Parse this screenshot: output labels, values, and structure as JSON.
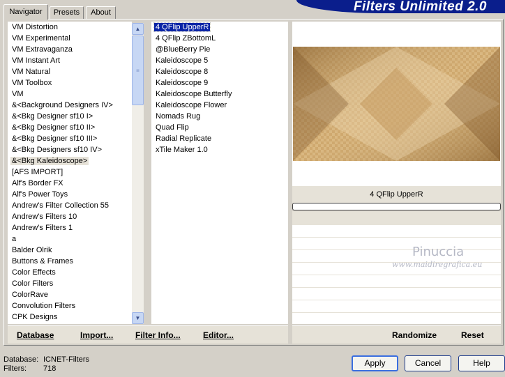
{
  "brand": {
    "title": "Filters Unlimited 2.0"
  },
  "tabs": [
    {
      "label": "Navigator"
    },
    {
      "label": "Presets"
    },
    {
      "label": "About"
    }
  ],
  "categories": [
    "VM Distortion",
    "VM Experimental",
    "VM Extravaganza",
    "VM Instant Art",
    "VM Natural",
    "VM Toolbox",
    "VM",
    "&<Background Designers IV>",
    "&<Bkg Designer sf10 I>",
    "&<Bkg Designer sf10 II>",
    "&<Bkg Designer sf10 III>",
    "&<Bkg Designers sf10 IV>",
    "&<Bkg Kaleidoscope>",
    "[AFS IMPORT]",
    "Alf's Border FX",
    "Alf's Power Toys",
    "Andrew's Filter Collection 55",
    "Andrew's Filters 10",
    "Andrew's Filters 1",
    "a",
    "Balder Olrik",
    "Buttons & Frames",
    "Color Effects",
    "Color Filters",
    "ColorRave",
    "Convolution Filters",
    "CPK Designs"
  ],
  "filters": [
    "4 QFlip UpperR",
    "4 QFlip ZBottomL",
    "@BlueBerry Pie",
    "Kaleidoscope 5",
    "Kaleidoscope 8",
    "Kaleidoscope 9",
    "Kaleidoscope Butterfly",
    "Kaleidoscope Flower",
    "Nomads Rug",
    "Quad Flip",
    "Radial Replicate",
    "xTile Maker 1.0"
  ],
  "preview": {
    "filter_name": "4 QFlip UpperR"
  },
  "watermark": {
    "name": "Pinuccia",
    "url": "www.maidiregrafica.eu"
  },
  "actions_left": {
    "database": "Database",
    "import": "Import...",
    "filter_info": "Filter Info...",
    "editor": "Editor..."
  },
  "actions_right": {
    "randomize": "Randomize",
    "reset": "Reset"
  },
  "status": {
    "database_label": "Database:",
    "database_value": "ICNET-Filters",
    "filters_label": "Filters:",
    "filters_value": "718"
  },
  "buttons": {
    "apply": "Apply",
    "cancel": "Cancel",
    "help": "Help"
  },
  "colors": {
    "brand_bg": "#0a1e8c",
    "selection": "#0a24a6",
    "dialog_bg": "#d4d0c8"
  }
}
